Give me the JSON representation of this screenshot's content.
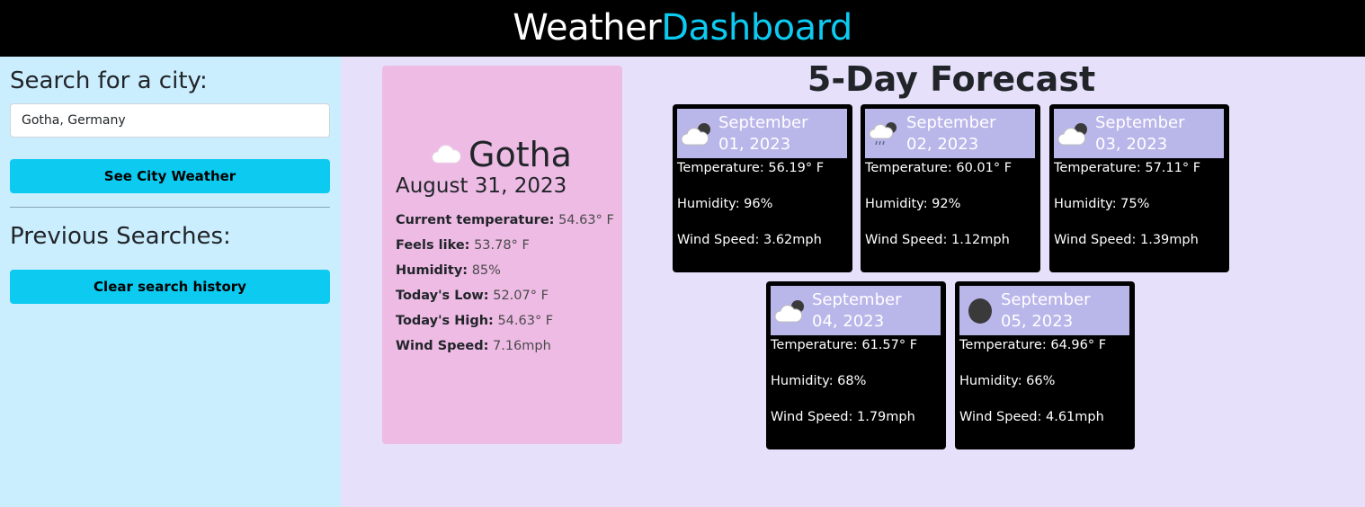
{
  "header": {
    "brand_part1": "Weather",
    "brand_part2": "Dashboard"
  },
  "sidebar": {
    "search_heading": "Search for a city:",
    "search_value": "Gotha, Germany",
    "search_button": "See City Weather",
    "previous_heading": "Previous Searches:",
    "clear_button": "Clear search history"
  },
  "current": {
    "icon": "cloud-icon",
    "city": "Gotha",
    "date": "August 31, 2023",
    "temperature_label": "Current temperature:",
    "temperature": "54.63° F",
    "feels_label": "Feels like:",
    "feels": "53.78° F",
    "humidity_label": "Humidity:",
    "humidity": "85%",
    "low_label": "Today's Low:",
    "low": "52.07° F",
    "high_label": "Today's High:",
    "high": "54.63° F",
    "wind_label": "Wind Speed:",
    "wind": "7.16mph"
  },
  "forecast": {
    "title": "5-Day Forecast",
    "days": [
      {
        "month": "September",
        "day": "01, 2023",
        "icon": "partly-cloudy-night-icon",
        "temp": "Temperature: 56.19° F",
        "humidity": "Humidity: 96%",
        "wind": "Wind Speed: 3.62mph"
      },
      {
        "month": "September",
        "day": "02, 2023",
        "icon": "rain-night-icon",
        "temp": "Temperature: 60.01° F",
        "humidity": "Humidity: 92%",
        "wind": "Wind Speed: 1.12mph"
      },
      {
        "month": "September",
        "day": "03, 2023",
        "icon": "partly-cloudy-night-icon",
        "temp": "Temperature: 57.11° F",
        "humidity": "Humidity: 75%",
        "wind": "Wind Speed: 1.39mph"
      },
      {
        "month": "September",
        "day": "04, 2023",
        "icon": "partly-cloudy-night-icon",
        "temp": "Temperature: 61.57° F",
        "humidity": "Humidity: 68%",
        "wind": "Wind Speed: 1.79mph"
      },
      {
        "month": "September",
        "day": "05, 2023",
        "icon": "moon-icon",
        "temp": "Temperature: 64.96° F",
        "humidity": "Humidity: 66%",
        "wind": "Wind Speed: 4.61mph"
      }
    ]
  },
  "colors": {
    "header_bg": "#000000",
    "accent": "#0dcaf0",
    "sidebar_bg": "#cbeefe",
    "main_bg": "#e6e0fb",
    "current_card_bg": "#eebbe5",
    "forecast_head_bg": "#b9b6ea"
  }
}
